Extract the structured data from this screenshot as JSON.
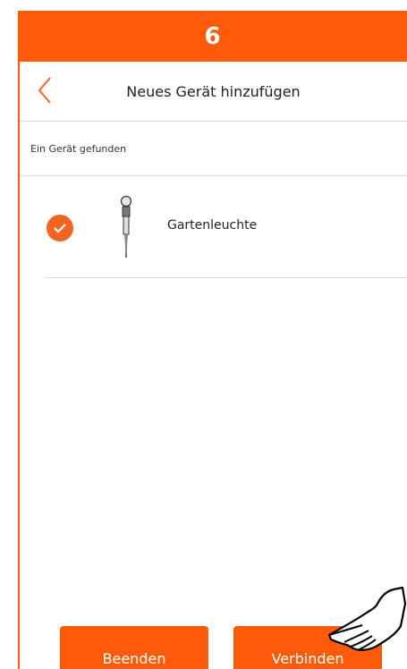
{
  "step": {
    "number": "6"
  },
  "header": {
    "title": "Neues Gerät hinzufügen"
  },
  "section": {
    "label": "Ein Gerät gefunden"
  },
  "device": {
    "name": "Gartenleuchte",
    "selected": true,
    "icon": "garden-light-icon"
  },
  "buttons": {
    "quit_label": "Beenden",
    "connect_label": "Verbinden"
  },
  "colors": {
    "accent": "#ff5a0a",
    "check": "#f26522"
  }
}
